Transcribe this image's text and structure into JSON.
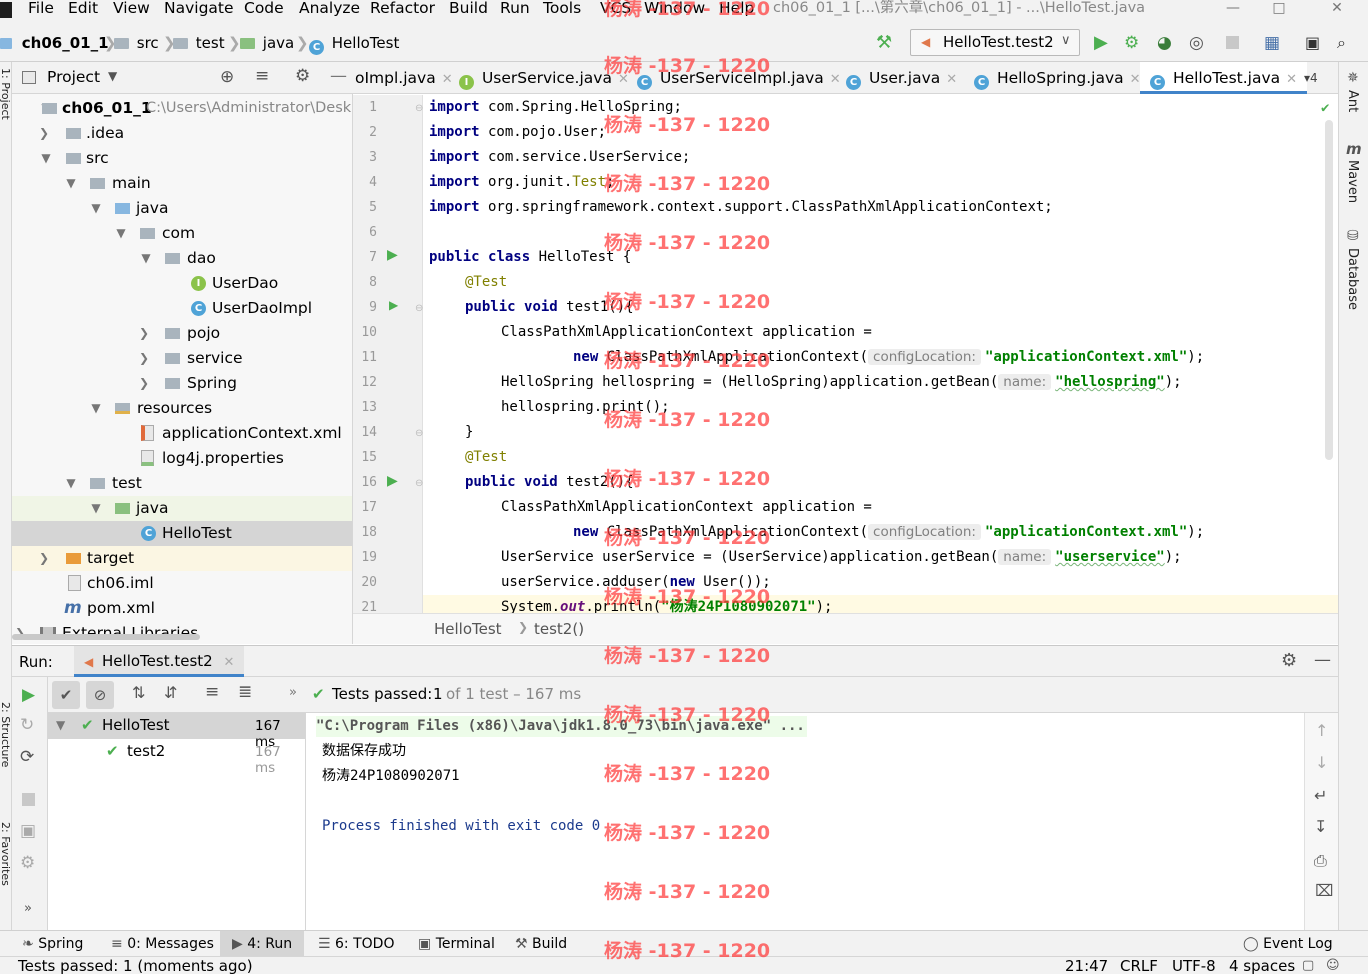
{
  "menubar": {
    "items": [
      "File",
      "Edit",
      "View",
      "Navigate",
      "Code",
      "Analyze",
      "Refactor",
      "Build",
      "Run",
      "Tools",
      "VCS",
      "Window",
      "Help"
    ],
    "title": "ch06_01_1 [...\\第六章\\ch06_01_1] - ...\\HelloTest.java"
  },
  "navbar": {
    "breadcrumbs": [
      "ch06_01_1",
      "src",
      "test",
      "java",
      "HelloTest"
    ],
    "run_config": "HelloTest.test2"
  },
  "project_panel": {
    "title": "Project",
    "tree": [
      {
        "label": "ch06_01_1",
        "extra": "C:\\Users\\Administrator\\Desk"
      },
      {
        "label": ".idea"
      },
      {
        "label": "src"
      },
      {
        "label": "main"
      },
      {
        "label": "java"
      },
      {
        "label": "com"
      },
      {
        "label": "dao"
      },
      {
        "label": "UserDao"
      },
      {
        "label": "UserDaoImpl"
      },
      {
        "label": "pojo"
      },
      {
        "label": "service"
      },
      {
        "label": "Spring"
      },
      {
        "label": "resources"
      },
      {
        "label": "applicationContext.xml"
      },
      {
        "label": "log4j.properties"
      },
      {
        "label": "test"
      },
      {
        "label": "java"
      },
      {
        "label": "HelloTest"
      },
      {
        "label": "target"
      },
      {
        "label": "ch06.iml"
      },
      {
        "label": "pom.xml"
      },
      {
        "label": "External Libraries"
      }
    ]
  },
  "editor": {
    "tabs": [
      "oImpl.java",
      "UserService.java",
      "UserServiceImpl.java",
      "User.java",
      "HelloSpring.java",
      "HelloTest.java"
    ],
    "tab_overflow": "4",
    "line_numbers": [
      "1",
      "2",
      "3",
      "4",
      "5",
      "6",
      "7",
      "8",
      "9",
      "10",
      "11",
      "12",
      "13",
      "14",
      "15",
      "16",
      "17",
      "18",
      "19",
      "20",
      "21"
    ],
    "code": {
      "l1_pkg": " com.Spring.HelloSpring;",
      "l2_pkg": " com.pojo.User;",
      "l3_pkg": " com.service.UserService;",
      "l4_pkg": " org.junit.",
      "l4_cls": "Test",
      "l5_pkg": " org.springframework.context.support.ClassPathXmlApplicationContext;",
      "kw_import": "import",
      "kw_public": "public",
      "kw_class": "class",
      "kw_void": "void",
      "kw_new": "new",
      "l7_rest": " HelloTest {",
      "ann_test": "@Test",
      "l9_rest": " test1(){",
      "l10": "ClassPathXmlApplicationContext application =",
      "l11_mid": " ClassPathXmlApplicationContext(",
      "hint_config": "configLocation:",
      "str_appctx": "\"applicationContext.xml\"",
      "close_semi": ");",
      "l12_a": "HelloSpring hellospring = (HelloSpring)application.getBean(",
      "hint_name": "name:",
      "str_hellospring": "\"hellospring\"",
      "l13": "hellospring.print();",
      "brace": "}",
      "l16_rest": " test2(){",
      "l19_a": "UserService userService = (UserService)application.getBean(",
      "str_userservice": "\"userservice\"",
      "l20_a": "userService.adduser(",
      "l20_b": " User());",
      "l21_a": "System.",
      "l21_out": "out",
      "l21_b": ".println(",
      "l21_str": "\"杨涛24P1080902071\"",
      "l21_c": ");"
    },
    "breadcrumb": [
      "HelloTest",
      "test2()"
    ]
  },
  "run_panel": {
    "label": "Run:",
    "tab": "HelloTest.test2",
    "tests_passed_label": "Tests passed:",
    "tests_passed_count": "1",
    "tests_passed_detail": "of 1 test – 167 ms",
    "test_tree": [
      {
        "name": "HelloTest",
        "time": "167 ms"
      },
      {
        "name": "test2",
        "time": "167 ms"
      }
    ],
    "console": [
      "\"C:\\Program Files (x86)\\Java\\jdk1.8.0_73\\bin\\java.exe\" ...",
      "数据保存成功",
      "杨涛24P1080902071",
      "",
      "Process finished with exit code 0"
    ]
  },
  "right_stripe": [
    "Ant",
    "Maven",
    "Database"
  ],
  "left_stripe": [
    "1: Project",
    "2: Structure",
    "2: Favorites"
  ],
  "tool_windows": [
    {
      "label": "Spring"
    },
    {
      "label": "0: Messages"
    },
    {
      "label": "4: Run"
    },
    {
      "label": "6: TODO"
    },
    {
      "label": "Terminal"
    },
    {
      "label": "Build"
    },
    {
      "label": "Event Log"
    }
  ],
  "statusbar": {
    "message": "Tests passed: 1 (moments ago)",
    "position": "21:47",
    "line_sep": "CRLF",
    "encoding": "UTF-8",
    "indent": "4 spaces"
  },
  "watermark": "杨涛 -137 - 1220",
  "colors": {
    "accent": "#4083c9",
    "keyword": "#000080",
    "string": "#008000",
    "annotation": "#808000",
    "success": "#4caf50",
    "watermark": "#ff3b3b"
  }
}
